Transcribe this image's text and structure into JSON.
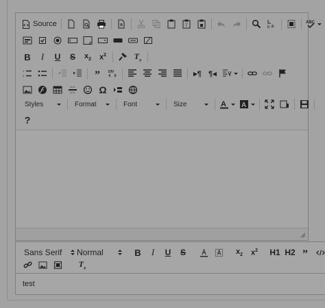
{
  "ckeditor": {
    "source_label": "Source",
    "icons": {
      "row1": [
        "new-page-icon",
        "preview-icon",
        "print-icon",
        "templates-icon",
        "cut-icon",
        "copy-icon",
        "paste-icon",
        "paste-text-icon",
        "paste-word-icon",
        "undo-icon",
        "redo-icon",
        "find-icon",
        "replace-icon",
        "select-all-icon",
        "spellcheck-icon"
      ],
      "row2": [
        "form-icon",
        "checkbox-icon",
        "radio-icon",
        "text-field-icon",
        "textarea-icon",
        "select-field-icon",
        "button-field-icon",
        "image-button-icon",
        "hidden-field-icon"
      ],
      "row3": [
        "bold-icon",
        "italic-icon",
        "underline-icon",
        "strike-icon",
        "subscript-icon",
        "superscript-icon",
        "copy-format-icon",
        "remove-format-icon"
      ],
      "row4": [
        "numbered-list-icon",
        "bulleted-list-icon",
        "outdent-icon",
        "indent-icon",
        "blockquote-icon",
        "div-icon",
        "align-left-icon",
        "align-center-icon",
        "align-right-icon",
        "justify-icon",
        "ltr-icon",
        "rtl-icon",
        "language-icon",
        "link-icon",
        "unlink-icon",
        "anchor-icon"
      ],
      "row5": [
        "image-icon",
        "flash-icon",
        "table-icon",
        "horizontal-rule-icon",
        "smiley-icon",
        "special-char-icon",
        "page-break-icon",
        "iframe-icon"
      ]
    },
    "combos": {
      "styles": "Styles",
      "format": "Format",
      "font": "Font",
      "size": "Size"
    },
    "help_label": "?"
  },
  "quill": {
    "font_picker": "Sans Serif",
    "size_picker": "Normal",
    "header1_label": "H1",
    "header2_label": "H2",
    "content_text": "test"
  }
}
